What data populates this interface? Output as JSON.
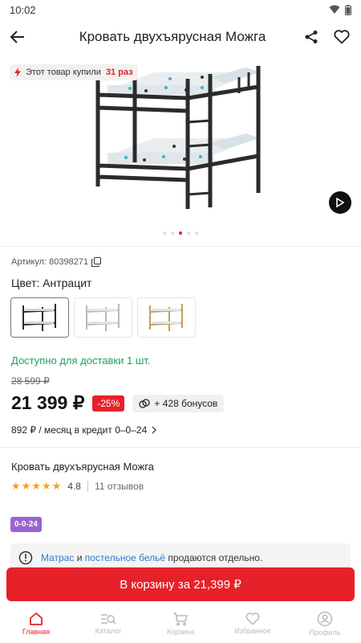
{
  "status": {
    "time": "10:02"
  },
  "header": {
    "title": "Кровать двухъярусная Можга"
  },
  "gallery": {
    "bought_prefix": "Этот товар купили",
    "bought_count": "31 раз",
    "dots": 5,
    "active_dot": 2
  },
  "product": {
    "article_label": "Артикул: 80398271",
    "color_label": "Цвет: Антрацит",
    "color_options": [
      "Антрацит",
      "Белый",
      "Натуральный"
    ],
    "availability": "Доступно для доставки 1 шт.",
    "old_price": "28 599 ₽",
    "price": "21 399 ₽",
    "discount": "-25%",
    "bonus": "+ 428 бонусов",
    "credit": "892 ₽ / месяц в кредит 0–0–24",
    "name": "Кровать двухъярусная Можга",
    "rating": "4.8",
    "rating_value": 4.8,
    "reviews": "11 отзывов",
    "tag": "0-0-24"
  },
  "notice": {
    "link1": "Матрас",
    "and": " и ",
    "link2": "постельное бельё",
    "rest": " продаются отдельно."
  },
  "cart_button": "В корзину за 21,399 ₽",
  "nav": {
    "items": [
      {
        "label": "Главная",
        "icon": "home-icon"
      },
      {
        "label": "Каталог",
        "icon": "catalog-icon"
      },
      {
        "label": "Корзина",
        "icon": "cart-icon"
      },
      {
        "label": "Избранное",
        "icon": "heart-icon"
      },
      {
        "label": "Профиль",
        "icon": "profile-icon"
      }
    ]
  },
  "colors": {
    "accent": "#e6212a",
    "green": "#1aa35b",
    "tag": "#9a64cf",
    "star": "#f7a11a",
    "link": "#2a7ecf"
  }
}
